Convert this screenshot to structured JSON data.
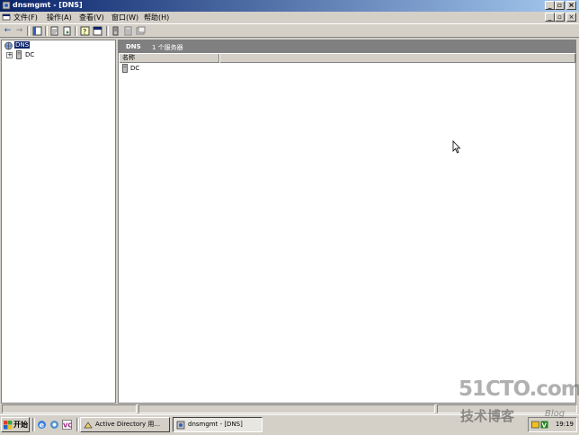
{
  "window": {
    "title": "dnsmgmt - [DNS]"
  },
  "title_controls": {
    "minimize": "_",
    "maximize": "▫",
    "close": "×"
  },
  "menu": {
    "items": [
      {
        "label": "文件(F)"
      },
      {
        "label": "操作(A)"
      },
      {
        "label": "查看(V)"
      },
      {
        "label": "窗口(W)"
      },
      {
        "label": "帮助(H)"
      }
    ]
  },
  "mdi_controls": {
    "minimize": "_",
    "restore": "▫",
    "close": "×"
  },
  "toolbar": {
    "icons": [
      "back-icon",
      "forward-icon",
      "console-tree-icon",
      "properties-icon",
      "export-list-icon",
      "help-icon",
      "show-hide-icon",
      "server-icon",
      "zone-list-icon",
      "refresh-icon"
    ]
  },
  "tree": {
    "root_label": "DNS",
    "children": [
      {
        "label": "DC",
        "expander": "+"
      }
    ]
  },
  "results": {
    "header_title": "DNS",
    "header_count": "1 个服务器",
    "columns": [
      {
        "label": "名称"
      },
      {
        "label": ""
      }
    ],
    "rows": [
      {
        "name": "DC"
      }
    ]
  },
  "taskbar": {
    "start_label": "开始",
    "quick_launch": [
      "ie-icon",
      "desktop-icon",
      "vc-icon"
    ],
    "tasks": [
      {
        "label": "Active Directory 用...",
        "active": false
      },
      {
        "label": "dnsmgmt - [DNS]",
        "active": true
      }
    ],
    "clock": "19:19"
  },
  "watermark": {
    "line1": "51CTO.com",
    "line2": "技术博客",
    "blog": "Blog"
  },
  "colors": {
    "titlebar_start": "#0a246a",
    "titlebar_end": "#a6caf0",
    "selection": "#0a246a",
    "result_header": "#808080"
  }
}
